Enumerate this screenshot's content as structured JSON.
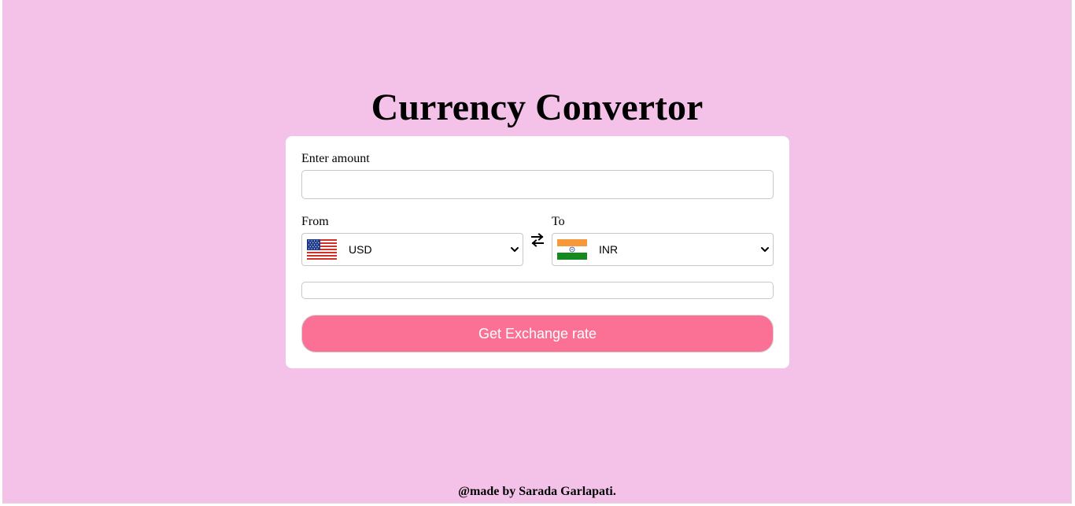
{
  "page": {
    "title": "Currency Convertor",
    "footer": "@made by Sarada Garlapati.",
    "background_color": "#f4c2e9"
  },
  "form": {
    "amount_label": "Enter amount",
    "amount_value": "",
    "from_label": "From",
    "to_label": "To",
    "from_currency": "USD",
    "to_currency": "INR",
    "from_flag_icon": "us-flag-icon",
    "to_flag_icon": "india-flag-icon",
    "swap_icon": "swap-arrows-icon",
    "result_text": "",
    "button_label": "Get Exchange rate",
    "button_color": "#fb7196"
  }
}
